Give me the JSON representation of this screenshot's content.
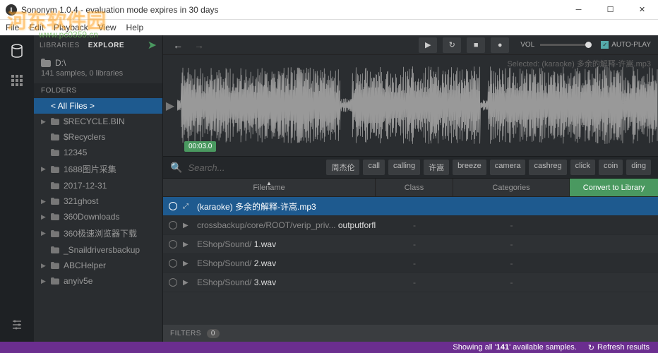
{
  "window": {
    "title": "Sononym 1.0.4 - evaluation mode expires in 30 days"
  },
  "menu": {
    "file": "File",
    "edit": "Edit",
    "playback": "Playback",
    "view": "View",
    "help": "Help"
  },
  "watermark": {
    "main": "河东软件园",
    "sub": "www.pc0359.cn"
  },
  "sidebar": {
    "tabs": {
      "libraries": "LIBRARIES",
      "explore": "EXPLORE"
    },
    "drive": {
      "name": "D:\\",
      "info": "141 samples, 0 libraries"
    },
    "folders_header": "FOLDERS",
    "items": [
      {
        "label": "< All Files >",
        "selected": true,
        "expandable": false
      },
      {
        "label": "$RECYCLE.BIN",
        "expandable": true
      },
      {
        "label": "$Recyclers",
        "expandable": false
      },
      {
        "label": "12345",
        "expandable": false
      },
      {
        "label": "1688图片采集",
        "expandable": true
      },
      {
        "label": "2017-12-31",
        "expandable": false
      },
      {
        "label": "321ghost",
        "expandable": true
      },
      {
        "label": "360Downloads",
        "expandable": true
      },
      {
        "label": "360极速浏览器下载",
        "expandable": true
      },
      {
        "label": "_Snaildriversbackup",
        "expandable": false
      },
      {
        "label": "ABCHelper",
        "expandable": true
      },
      {
        "label": "anyiv5e",
        "expandable": true
      }
    ]
  },
  "player": {
    "vol_label": "VOL",
    "autoplay_label": "AUTO-PLAY",
    "autoplay_checked": true,
    "selected_label": "Selected: (karaoke) 多余的解释-许嵩.mp3",
    "timecode": "00:03.0"
  },
  "search": {
    "placeholder": "Search...",
    "tags": [
      "周杰伦",
      "call",
      "calling",
      "许嵩",
      "breeze",
      "camera",
      "cashreg",
      "click",
      "coin",
      "ding"
    ]
  },
  "table": {
    "headers": {
      "filename": "Filename",
      "class": "Class",
      "categories": "Categories"
    },
    "convert": "Convert to Library",
    "rows": [
      {
        "path": "",
        "file": "(karaoke) 多余的解释-许嵩.mp3",
        "class": "",
        "cat": "",
        "selected": true,
        "icon": "expand"
      },
      {
        "path": "crossbackup/core/ROOT/verip_priv... ",
        "file": "outputforflash.fla",
        "class": "-",
        "cat": "-",
        "icon": "play"
      },
      {
        "path": "EShop/Sound/ ",
        "file": "1.wav",
        "class": "-",
        "cat": "-",
        "icon": "play"
      },
      {
        "path": "EShop/Sound/ ",
        "file": "2.wav",
        "class": "-",
        "cat": "-",
        "icon": "play"
      },
      {
        "path": "EShop/Sound/ ",
        "file": "3.wav",
        "class": "-",
        "cat": "-",
        "icon": "play"
      }
    ]
  },
  "filters": {
    "label": "FILTERS",
    "count": "0"
  },
  "status": {
    "showing_pre": "Showing all '",
    "showing_count": "141",
    "showing_post": "' available samples.",
    "refresh": "Refresh results"
  }
}
